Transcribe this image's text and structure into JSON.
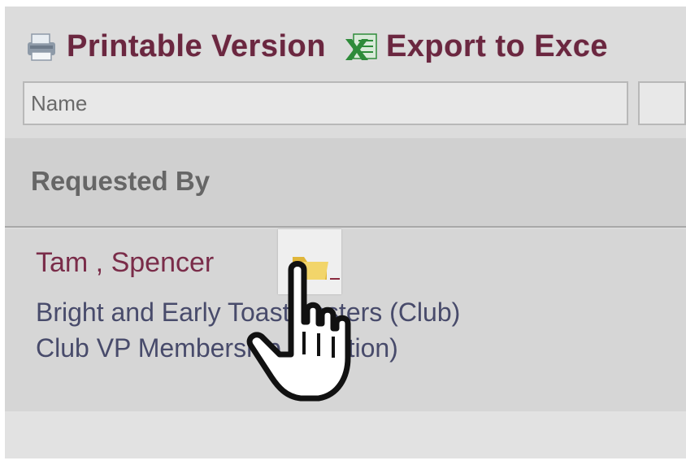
{
  "toolbar": {
    "printable_label": "Printable Version",
    "export_label": "Export to Exce",
    "printable_icon": "printer-icon",
    "export_icon": "excel-icon"
  },
  "filters": {
    "name_placeholder": "Name"
  },
  "table": {
    "column_header": "Requested By",
    "rows": [
      {
        "name": "Tam , Spencer",
        "club": "Bright and Early Toastmasters (Club)",
        "position": "Club VP Membership (Position)",
        "folder_icon": "folder-icon"
      }
    ]
  },
  "cursor": {
    "icon": "hand-pointer-icon"
  },
  "colors": {
    "link": "#6b2740",
    "name": "#7a2c49",
    "detail": "#484b6b",
    "header_text": "#666666",
    "excel_green": "#2e8b3a"
  }
}
